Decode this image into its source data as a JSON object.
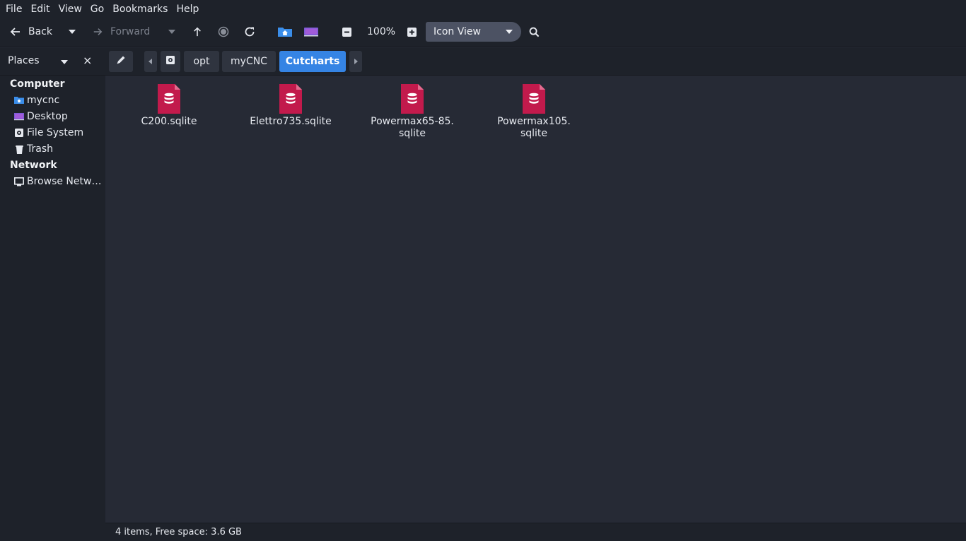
{
  "menu": [
    "File",
    "Edit",
    "View",
    "Go",
    "Bookmarks",
    "Help"
  ],
  "toolbar": {
    "back_label": "Back",
    "forward_label": "Forward",
    "zoom": "100%",
    "view_mode": "Icon View"
  },
  "sidebar": {
    "header": "Places",
    "close": "×",
    "sections": {
      "computer": "Computer",
      "network": "Network"
    },
    "items": {
      "mycnc": "mycnc",
      "desktop": "Desktop",
      "filesystem": "File System",
      "trash": "Trash",
      "browse_network": "Browse Network"
    }
  },
  "pathbar": {
    "segments": [
      "opt",
      "myCNC",
      "Cutcharts"
    ]
  },
  "files": [
    {
      "line1": "C200.sqlite",
      "line2": ""
    },
    {
      "line1": "Elettro735.sqlite",
      "line2": ""
    },
    {
      "line1": "Powermax65-85.",
      "line2": "sqlite"
    },
    {
      "line1": "Powermax105.",
      "line2": "sqlite"
    }
  ],
  "status": "4 items, Free space: 3.6 GB",
  "colors": {
    "accent": "#3584e4",
    "file_icon": "#c21a4c",
    "background": "#262a35",
    "panel": "#1e222a"
  }
}
